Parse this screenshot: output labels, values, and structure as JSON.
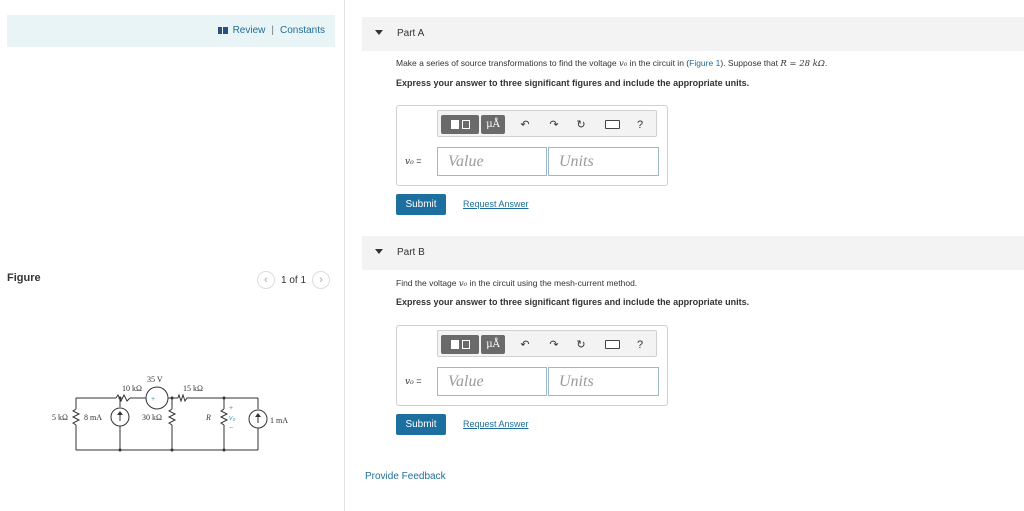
{
  "header": {
    "review_label": "Review",
    "separator": "|",
    "constants_label": "Constants"
  },
  "figure_panel": {
    "title": "Figure",
    "pager_text": "1 of 1",
    "prev_icon": "chevron-left-icon",
    "next_icon": "chevron-right-icon"
  },
  "circuit": {
    "source_35v": "35 V",
    "r_10k": "10 kΩ",
    "r_15k": "15 kΩ",
    "r_5k": "5 kΩ",
    "src_8ma": "8 mA",
    "r_30k": "30 kΩ",
    "r_R": "R",
    "v0": "v₀",
    "src_1ma": "1 mA",
    "plus": "+",
    "minus": "−"
  },
  "part_a": {
    "title": "Part A",
    "question_pre": "Make a series of source transformations to find the voltage ",
    "question_var": "v₀",
    "question_mid": " in the circuit in (",
    "question_link": "Figure 1",
    "question_post": "). Suppose that ",
    "question_eq": "R = 28  kΩ",
    "question_end": ".",
    "instruction": "Express your answer to three significant figures and include the appropriate units.",
    "answer_label": "v₀",
    "answer_eq": " =",
    "value_placeholder": "Value",
    "units_placeholder": "Units",
    "submit_label": "Submit",
    "request_label": "Request Answer"
  },
  "part_b": {
    "title": "Part B",
    "question_pre": "Find the voltage ",
    "question_var": "v₀",
    "question_post": " in the circuit using the mesh-current method.",
    "instruction": "Express your answer to three significant figures and include the appropriate units.",
    "answer_label": "v₀",
    "answer_eq": " =",
    "value_placeholder": "Value",
    "units_placeholder": "Units",
    "submit_label": "Submit",
    "request_label": "Request Answer"
  },
  "toolbar": {
    "units_label": "μÅ",
    "undo_icon": "undo-icon",
    "redo_icon": "redo-icon",
    "reset_icon": "reset-icon",
    "keyboard_icon": "keyboard-icon",
    "help_label": "?"
  },
  "footer": {
    "feedback_label": "Provide Feedback"
  }
}
